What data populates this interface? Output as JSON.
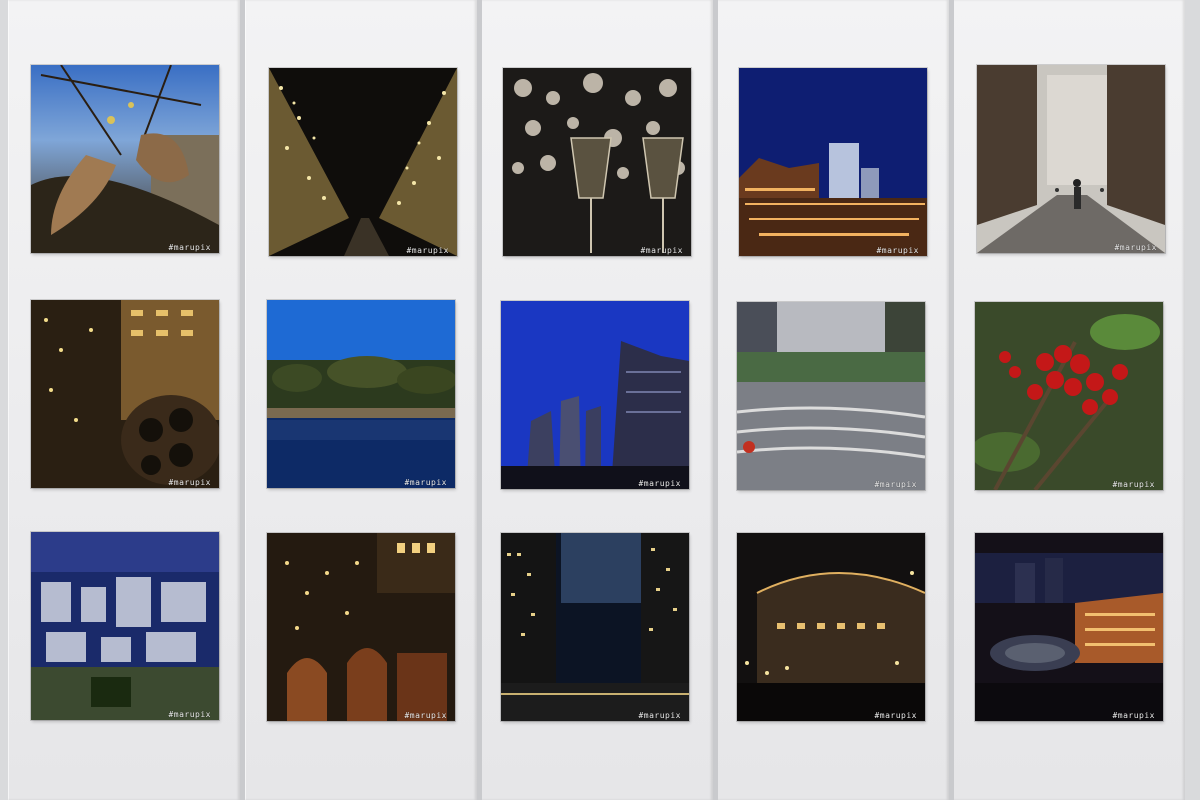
{
  "gallery": {
    "watermark": "#marupix",
    "colors": {
      "wall": "#ececee",
      "seam": "#c9cacd"
    },
    "photos": [
      {
        "subject": "withered-leaves-icon"
      },
      {
        "subject": "illuminated-avenue-icon"
      },
      {
        "subject": "champagne-glasses-icon"
      },
      {
        "subject": "station-night-icon"
      },
      {
        "subject": "marathon-street-icon"
      },
      {
        "subject": "lit-trees-sculpture-icon"
      },
      {
        "subject": "palace-garden-pond-icon"
      },
      {
        "subject": "skyscrapers-blue-sky-icon"
      },
      {
        "subject": "plaza-tilt-shift-icon"
      },
      {
        "subject": "red-berries-icon"
      },
      {
        "subject": "aerial-city-icon"
      },
      {
        "subject": "lit-trees-bronze-sculpture-icon"
      },
      {
        "subject": "night-towers-icon"
      },
      {
        "subject": "arched-building-lights-icon"
      },
      {
        "subject": "station-aerial-night-icon"
      }
    ]
  }
}
